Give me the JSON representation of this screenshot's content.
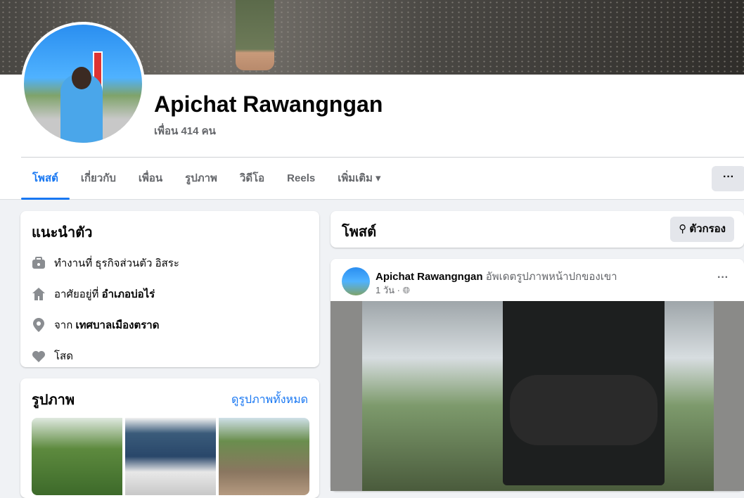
{
  "profile": {
    "name": "Apichat Rawangngan",
    "friends": "เพื่อน 414 คน"
  },
  "tabs": [
    {
      "label": "โพสต์"
    },
    {
      "label": "เกี่ยวกับ"
    },
    {
      "label": "เพื่อน"
    },
    {
      "label": "รูปภาพ"
    },
    {
      "label": "วิดีโอ"
    },
    {
      "label": "Reels"
    },
    {
      "label": "เพิ่มเติม ▾"
    }
  ],
  "more_label": "···",
  "intro": {
    "title": "แนะนำตัว",
    "items": [
      {
        "icon": "briefcase-icon",
        "prefix": "ทำงานที่ ธุรกิจส่วนตัว อิสระ",
        "bold": ""
      },
      {
        "icon": "home-icon",
        "prefix": "อาศัยอยู่ที่ ",
        "bold": "อำเภอบ่อไร่"
      },
      {
        "icon": "location-pin-icon",
        "prefix": "จาก ",
        "bold": "เทศบาลเมืองตราด"
      },
      {
        "icon": "heart-icon",
        "prefix": "โสด",
        "bold": ""
      }
    ]
  },
  "photos": {
    "title": "รูปภาพ",
    "see_all": "ดูรูปภาพทั้งหมด"
  },
  "posts": {
    "title": "โพสต์",
    "filter": "ตัวกรอง"
  },
  "post": {
    "author": "Apichat Rawangngan",
    "action": "อัพเดตรูปภาพหน้าปกของเขา",
    "time": "1 วัน ·",
    "more": "···"
  },
  "colors": {
    "accent": "#1877f2"
  }
}
